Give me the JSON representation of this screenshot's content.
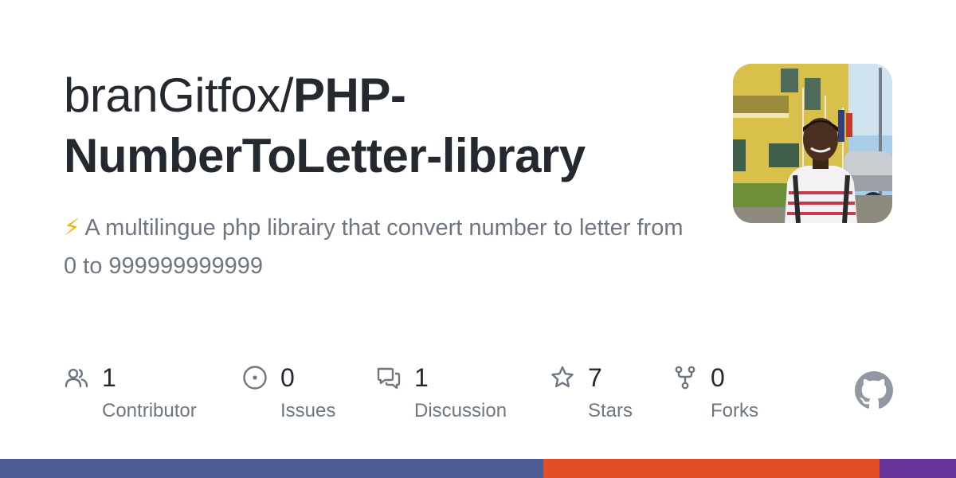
{
  "repo": {
    "owner": "branGitfox/",
    "name": "PHP-NumberToLetter-library",
    "description_icon": "high-voltage-emoji",
    "description_bolt": "⚡",
    "description": "A multilingue php librairy that convert number to letter from 0 to 999999999999"
  },
  "avatar": {
    "icon": "user-avatar-photo"
  },
  "stats": [
    {
      "icon": "people-icon",
      "count": "1",
      "label": "Contributor"
    },
    {
      "icon": "issue-opened-icon",
      "count": "0",
      "label": "Issues"
    },
    {
      "icon": "comment-discussion-icon",
      "count": "1",
      "label": "Discussion"
    },
    {
      "icon": "star-icon",
      "count": "7",
      "label": "Stars"
    },
    {
      "icon": "repo-forked-icon",
      "count": "0",
      "label": "Forks"
    }
  ],
  "brand": {
    "icon": "github-mark-icon",
    "color": "#9198a1"
  },
  "languages": [
    {
      "color": "#4f5d95",
      "share": 0.568
    },
    {
      "color": "#e34c26",
      "share": 0.352
    },
    {
      "color": "#663399",
      "share": 0.08
    }
  ]
}
